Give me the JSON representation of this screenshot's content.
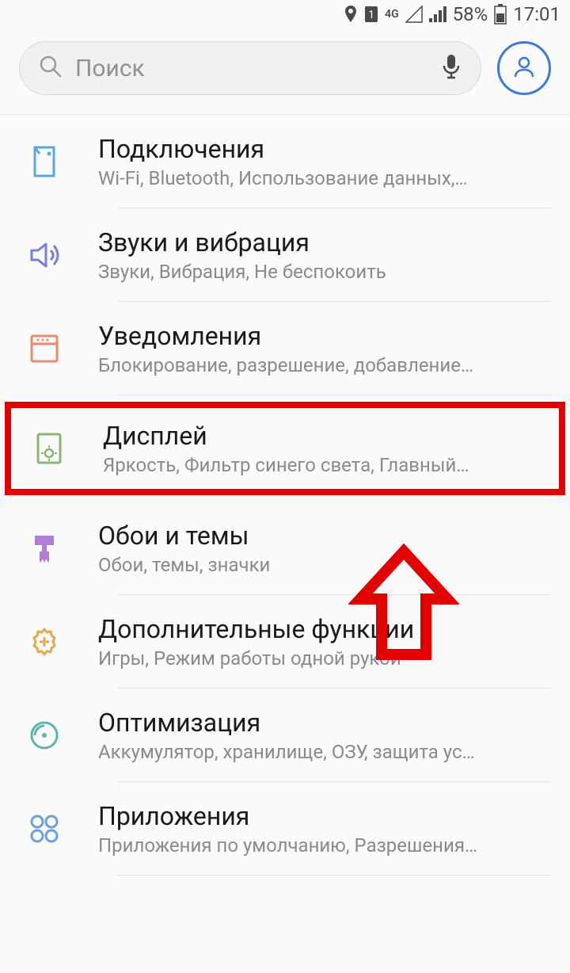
{
  "status": {
    "battery_percent": "58%",
    "time": "17:01",
    "network_label": "4G",
    "sim_label": "1"
  },
  "search": {
    "placeholder": "Поиск"
  },
  "settings": [
    {
      "id": "connections",
      "title": "Подключения",
      "subtitle": "Wi-Fi, Bluetooth, Использование данных,…",
      "icon": "connections-icon",
      "color": "#5ba7e0",
      "highlighted": false
    },
    {
      "id": "sounds",
      "title": "Звуки и вибрация",
      "subtitle": "Звуки, Вибрация, Не беспокоить",
      "icon": "sound-icon",
      "color": "#7a7de0",
      "highlighted": false
    },
    {
      "id": "notifications",
      "title": "Уведомления",
      "subtitle": "Блокирование, разрешение, добавление…",
      "icon": "notifications-icon",
      "color": "#e88a6e",
      "highlighted": false
    },
    {
      "id": "display",
      "title": "Дисплей",
      "subtitle": "Яркость, Фильтр синего света, Главный…",
      "icon": "display-icon",
      "color": "#8cb56e",
      "highlighted": true
    },
    {
      "id": "wallpaper",
      "title": "Обои и темы",
      "subtitle": "Обои, темы, значки",
      "icon": "brush-icon",
      "color": "#b07fd3",
      "highlighted": false
    },
    {
      "id": "advanced",
      "title": "Дополнительные функции",
      "subtitle": "Игры, Режим работы одной рукой",
      "icon": "gear-plus-icon",
      "color": "#e6a84a",
      "highlighted": false
    },
    {
      "id": "maintenance",
      "title": "Оптимизация",
      "subtitle": "Аккумулятор, хранилище, ОЗУ, защита ус…",
      "icon": "optimize-icon",
      "color": "#5cb3b0",
      "highlighted": false
    },
    {
      "id": "apps",
      "title": "Приложения",
      "subtitle": "Приложения по умолчанию, Разрешения…",
      "icon": "apps-icon",
      "color": "#6a9fe0",
      "highlighted": false
    }
  ]
}
